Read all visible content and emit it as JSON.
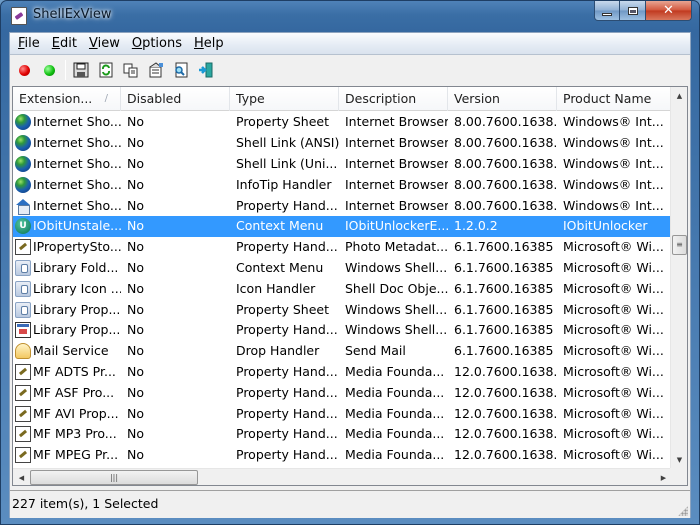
{
  "window": {
    "title": "ShellExView",
    "caption_buttons": {
      "minimize": "minimize",
      "maximize": "maximize",
      "close": "✕"
    }
  },
  "menu": [
    {
      "label": "File",
      "accel": "F",
      "rest": "ile"
    },
    {
      "label": "Edit",
      "accel": "E",
      "rest": "dit"
    },
    {
      "label": "View",
      "accel": "V",
      "rest": "iew"
    },
    {
      "label": "Options",
      "accel": "O",
      "rest": "ptions"
    },
    {
      "label": "Help",
      "accel": "H",
      "rest": "elp"
    }
  ],
  "toolbar": {
    "buttons": [
      {
        "name": "disable-selected",
        "icon": "red-dot-icon",
        "color": "#e00000"
      },
      {
        "name": "enable-selected",
        "icon": "green-dot-icon",
        "color": "#10c010"
      },
      {
        "name": "save-selected",
        "icon": "floppy-disk-icon"
      },
      {
        "name": "refresh",
        "icon": "refresh-icon"
      },
      {
        "name": "copy-selected",
        "icon": "copy-icon"
      },
      {
        "name": "properties",
        "icon": "properties-icon"
      },
      {
        "name": "find",
        "icon": "find-icon"
      },
      {
        "name": "exit",
        "icon": "exit-icon"
      }
    ]
  },
  "list": {
    "columns": [
      "Extension...",
      "Disabled",
      "Type",
      "Description",
      "Version",
      "Product Name"
    ],
    "sort_column": 0,
    "selected_color": "#3399ff",
    "rows": [
      {
        "icon": "globe",
        "name": "Internet Sho...",
        "disabled": "No",
        "type": "Property Sheet",
        "description": "Internet Browser",
        "version": "8.00.7600.1638...",
        "product": "Windows® Int..."
      },
      {
        "icon": "globe",
        "name": "Internet Sho...",
        "disabled": "No",
        "type": "Shell Link (ANSI)",
        "description": "Internet Browser",
        "version": "8.00.7600.1638...",
        "product": "Windows® Int..."
      },
      {
        "icon": "globe",
        "name": "Internet Sho...",
        "disabled": "No",
        "type": "Shell Link (Uni...",
        "description": "Internet Browser",
        "version": "8.00.7600.1638...",
        "product": "Windows® Int..."
      },
      {
        "icon": "globe",
        "name": "Internet Sho...",
        "disabled": "No",
        "type": "InfoTip Handler",
        "description": "Internet Browser",
        "version": "8.00.7600.1638...",
        "product": "Windows® Int..."
      },
      {
        "icon": "house",
        "name": "Internet Sho...",
        "disabled": "No",
        "type": "Property Hand...",
        "description": "Internet Browser",
        "version": "8.00.7600.1638...",
        "product": "Windows® Int..."
      },
      {
        "icon": "iobit",
        "name": "IObitUnstale...",
        "disabled": "No",
        "type": "Context Menu",
        "description": "IObitUnlockerE...",
        "version": "1.2.0.2",
        "product": "IObitUnlocker",
        "selected": true
      },
      {
        "icon": "doc",
        "name": "IPropertySto...",
        "disabled": "No",
        "type": "Property Hand...",
        "description": "Photo Metadat...",
        "version": "6.1.7600.16385 ...",
        "product": "Microsoft® Wi..."
      },
      {
        "icon": "lib",
        "name": "Library Fold...",
        "disabled": "No",
        "type": "Context Menu",
        "description": "Windows Shell...",
        "version": "6.1.7600.16385 ...",
        "product": "Microsoft® Wi..."
      },
      {
        "icon": "lib",
        "name": "Library Icon ...",
        "disabled": "No",
        "type": "Icon Handler",
        "description": "Shell Doc Obje...",
        "version": "6.1.7600.16385 ...",
        "product": "Microsoft® Wi..."
      },
      {
        "icon": "lib",
        "name": "Library Prop...",
        "disabled": "No",
        "type": "Property Sheet",
        "description": "Windows Shell...",
        "version": "6.1.7600.16385 ...",
        "product": "Microsoft® Wi..."
      },
      {
        "icon": "cal",
        "name": "Library Prop...",
        "disabled": "No",
        "type": "Property Hand...",
        "description": "Windows Shell...",
        "version": "6.1.7600.16385 ...",
        "product": "Microsoft® Wi..."
      },
      {
        "icon": "mail",
        "name": "Mail Service",
        "disabled": "No",
        "type": "Drop Handler",
        "description": "Send Mail",
        "version": "6.1.7600.16385 ...",
        "product": "Microsoft® Wi..."
      },
      {
        "icon": "doc",
        "name": "MF ADTS Pr...",
        "disabled": "No",
        "type": "Property Hand...",
        "description": "Media Founda...",
        "version": "12.0.7600.1638...",
        "product": "Microsoft® Wi..."
      },
      {
        "icon": "doc",
        "name": "MF ASF Pro...",
        "disabled": "No",
        "type": "Property Hand...",
        "description": "Media Founda...",
        "version": "12.0.7600.1638...",
        "product": "Microsoft® Wi..."
      },
      {
        "icon": "doc",
        "name": "MF AVI Prop...",
        "disabled": "No",
        "type": "Property Hand...",
        "description": "Media Founda...",
        "version": "12.0.7600.1638...",
        "product": "Microsoft® Wi..."
      },
      {
        "icon": "doc",
        "name": "MF MP3 Pro...",
        "disabled": "No",
        "type": "Property Hand...",
        "description": "Media Founda...",
        "version": "12.0.7600.1638...",
        "product": "Microsoft® Wi..."
      },
      {
        "icon": "doc",
        "name": "MF MPEG Pr...",
        "disabled": "No",
        "type": "Property Hand...",
        "description": "Media Founda...",
        "version": "12.0.7600.1638...",
        "product": "Microsoft® Wi..."
      }
    ]
  },
  "scrollbars": {
    "vertical_position_fraction": 0.4,
    "horizontal_position_fraction": 0.0
  },
  "status": {
    "text": "227 item(s), 1 Selected"
  }
}
